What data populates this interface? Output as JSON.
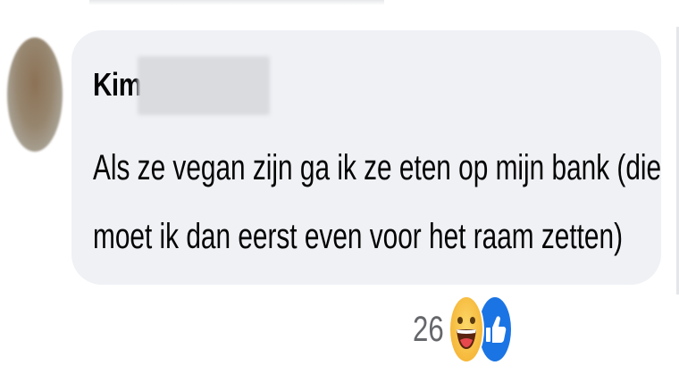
{
  "comment": {
    "author": "Kim",
    "text_lines": [
      "Als ze vegan zijn ga ik ze eten op mijn bank (die",
      "moet ik dan eerst even voor het raam zetten)"
    ]
  },
  "reactions": {
    "count": "26",
    "icons": [
      "haha-emoji-icon",
      "like-thumb-icon"
    ],
    "colors": {
      "haha": "#f6b83a",
      "like": "#1b74e4"
    }
  },
  "colors": {
    "bubble": "#eff1f5",
    "text": "#050505",
    "count": "#65676b"
  }
}
